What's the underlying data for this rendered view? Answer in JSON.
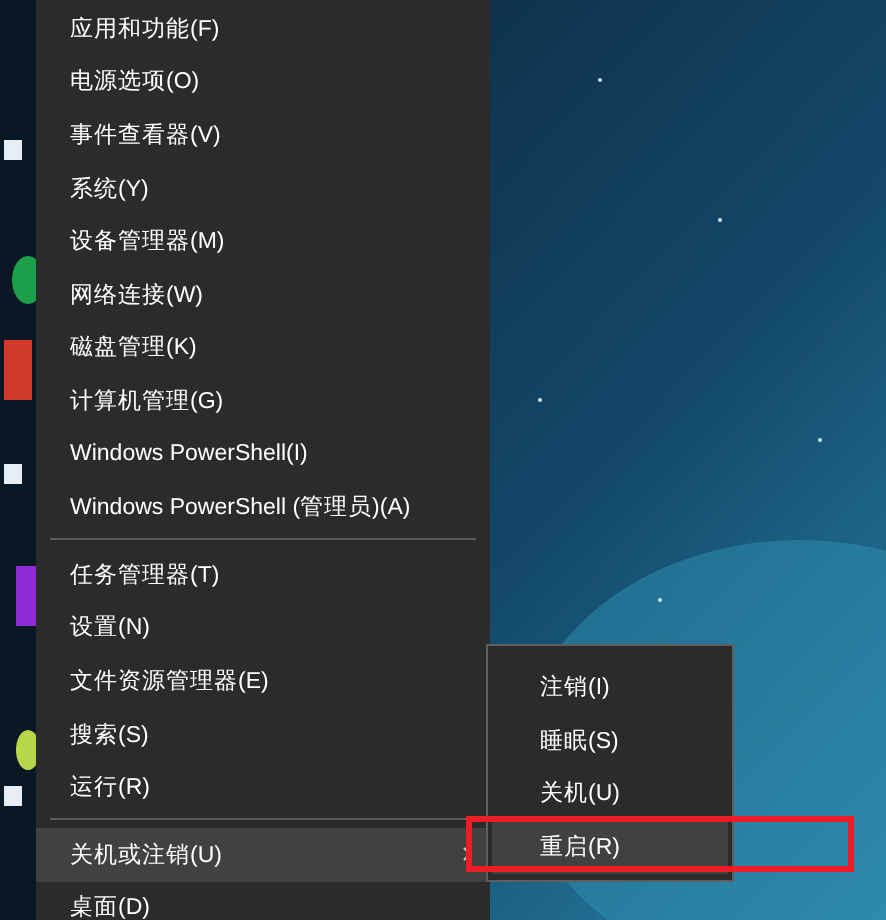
{
  "menu": {
    "items": [
      {
        "kind": "item",
        "label": "应用和功能(F)",
        "selected": false
      },
      {
        "kind": "item",
        "label": "电源选项(O)",
        "selected": false
      },
      {
        "kind": "item",
        "label": "事件查看器(V)",
        "selected": false
      },
      {
        "kind": "item",
        "label": "系统(Y)",
        "selected": false
      },
      {
        "kind": "item",
        "label": "设备管理器(M)",
        "selected": false
      },
      {
        "kind": "item",
        "label": "网络连接(W)",
        "selected": false
      },
      {
        "kind": "item",
        "label": "磁盘管理(K)",
        "selected": false
      },
      {
        "kind": "item",
        "label": "计算机管理(G)",
        "selected": false
      },
      {
        "kind": "item",
        "label": "Windows PowerShell(I)",
        "selected": false
      },
      {
        "kind": "item",
        "label": "Windows PowerShell (管理员)(A)",
        "selected": false
      },
      {
        "kind": "separator"
      },
      {
        "kind": "item",
        "label": "任务管理器(T)",
        "selected": false
      },
      {
        "kind": "item",
        "label": "设置(N)",
        "selected": false
      },
      {
        "kind": "item",
        "label": "文件资源管理器(E)",
        "selected": false
      },
      {
        "kind": "item",
        "label": "搜索(S)",
        "selected": false
      },
      {
        "kind": "item",
        "label": "运行(R)",
        "selected": false
      },
      {
        "kind": "separator"
      },
      {
        "kind": "submenu",
        "label": "关机或注销(U)",
        "selected": true
      },
      {
        "kind": "item",
        "label": "桌面(D)",
        "selected": false
      }
    ]
  },
  "submenu": {
    "items": [
      {
        "label": "注销(I)",
        "selected": false,
        "highlighted": false
      },
      {
        "label": "睡眠(S)",
        "selected": false,
        "highlighted": false
      },
      {
        "label": "关机(U)",
        "selected": false,
        "highlighted": false
      },
      {
        "label": "重启(R)",
        "selected": true,
        "highlighted": true
      }
    ]
  }
}
